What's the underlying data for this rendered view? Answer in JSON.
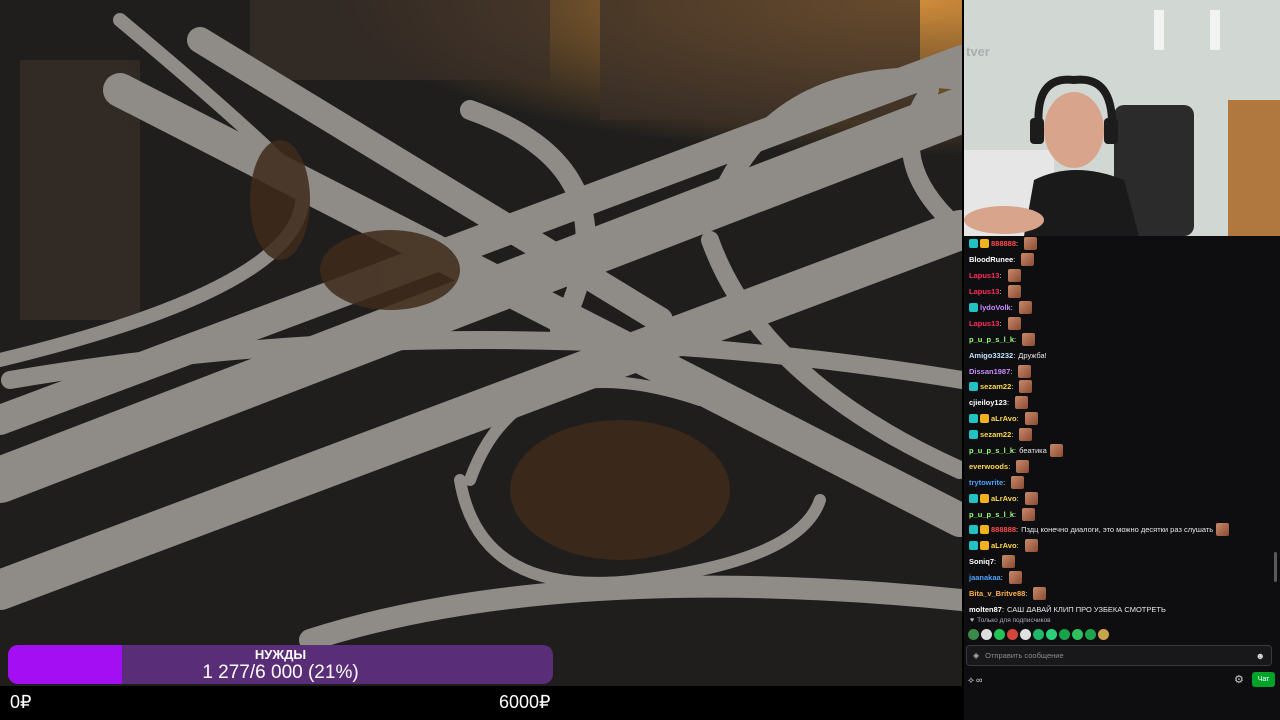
{
  "goal": {
    "title": "НУЖДЫ",
    "value_text": "1 277/6 000 (21%)",
    "progress": 0.21,
    "min_label": "0₽",
    "max_label": "6000₽",
    "fill_color": "#a30ef2",
    "track_color": "#5a2d78"
  },
  "webcam": {
    "watermark": "tver"
  },
  "chat": {
    "messages": [
      {
        "user": "888888",
        "color": "#ff4d4d",
        "text": "",
        "badges": [
          "sub",
          "crown"
        ],
        "emote": true
      },
      {
        "user": "BloodRunee",
        "color": "#ffffff",
        "text": "",
        "badges": [],
        "emote": true
      },
      {
        "user": "Lapus13",
        "color": "#ff2d5a",
        "text": "",
        "badges": [],
        "emote": true
      },
      {
        "user": "Lapus13",
        "color": "#ff2d5a",
        "text": "",
        "badges": [],
        "emote": true
      },
      {
        "user": "lydoVolk",
        "color": "#c98bff",
        "text": "",
        "badges": [
          "sub"
        ],
        "emote": true
      },
      {
        "user": "Lapus13",
        "color": "#ff2d5a",
        "text": "",
        "badges": [],
        "emote": true
      },
      {
        "user": "p_u_p_s_l_k",
        "color": "#9cff7a",
        "text": "",
        "badges": [],
        "emote": true
      },
      {
        "user": "Amigo33232",
        "color": "#bfe3ff",
        "text": "Дружба!",
        "badges": [],
        "emote": false
      },
      {
        "user": "Dissan1987",
        "color": "#c98bff",
        "text": "",
        "badges": [],
        "emote": true
      },
      {
        "user": "sezam22",
        "color": "#ffd84d",
        "text": "",
        "badges": [
          "sub"
        ],
        "emote": true
      },
      {
        "user": "cjieiloy123",
        "color": "#ffffff",
        "text": "",
        "badges": [],
        "emote": true
      },
      {
        "user": "aLrAvo",
        "color": "#ffd84d",
        "text": "",
        "badges": [
          "sub",
          "crown"
        ],
        "emote": true
      },
      {
        "user": "sezam22",
        "color": "#ffd84d",
        "text": "",
        "badges": [
          "sub"
        ],
        "emote": true
      },
      {
        "user": "p_u_p_s_l_k",
        "color": "#9cff7a",
        "text": "беатика",
        "badges": [],
        "emote": true
      },
      {
        "user": "everwoods",
        "color": "#ffd84d",
        "text": "",
        "badges": [],
        "emote": true
      },
      {
        "user": "trytowrite",
        "color": "#4da3ff",
        "text": "",
        "badges": [],
        "emote": true
      },
      {
        "user": "aLrAvo",
        "color": "#ffd84d",
        "text": "",
        "badges": [
          "sub",
          "crown"
        ],
        "emote": true
      },
      {
        "user": "p_u_p_s_l_k",
        "color": "#9cff7a",
        "text": "",
        "badges": [],
        "emote": true
      },
      {
        "user": "888888",
        "color": "#ff4d4d",
        "text": "Пздц конечно диалоги, это можно десятки раз слушать",
        "badges": [
          "sub",
          "crown"
        ],
        "emote": true
      },
      {
        "user": "aLrAvo",
        "color": "#ffd84d",
        "text": "",
        "badges": [
          "sub",
          "crown"
        ],
        "emote": true
      },
      {
        "user": "Soniq7",
        "color": "#ffffff",
        "text": "",
        "badges": [],
        "emote": true
      },
      {
        "user": "jaanakaa",
        "color": "#4da3ff",
        "text": "",
        "badges": [],
        "emote": true
      },
      {
        "user": "Bita_v_Britve88",
        "color": "#ffb14d",
        "text": "",
        "badges": [],
        "emote": true
      },
      {
        "user": "molten87",
        "color": "#ffffff",
        "text": "САШ ДАВАЙ КЛИП ПРО УЗБЕКА СМОТРЕТЬ",
        "badges": [],
        "emote": false
      }
    ],
    "sub_only_note": "Только для подписчиков",
    "input_placeholder": "Отправить сообщение",
    "points_value": "∞",
    "send_label": "Чат",
    "accent_color": "#00a32a"
  }
}
